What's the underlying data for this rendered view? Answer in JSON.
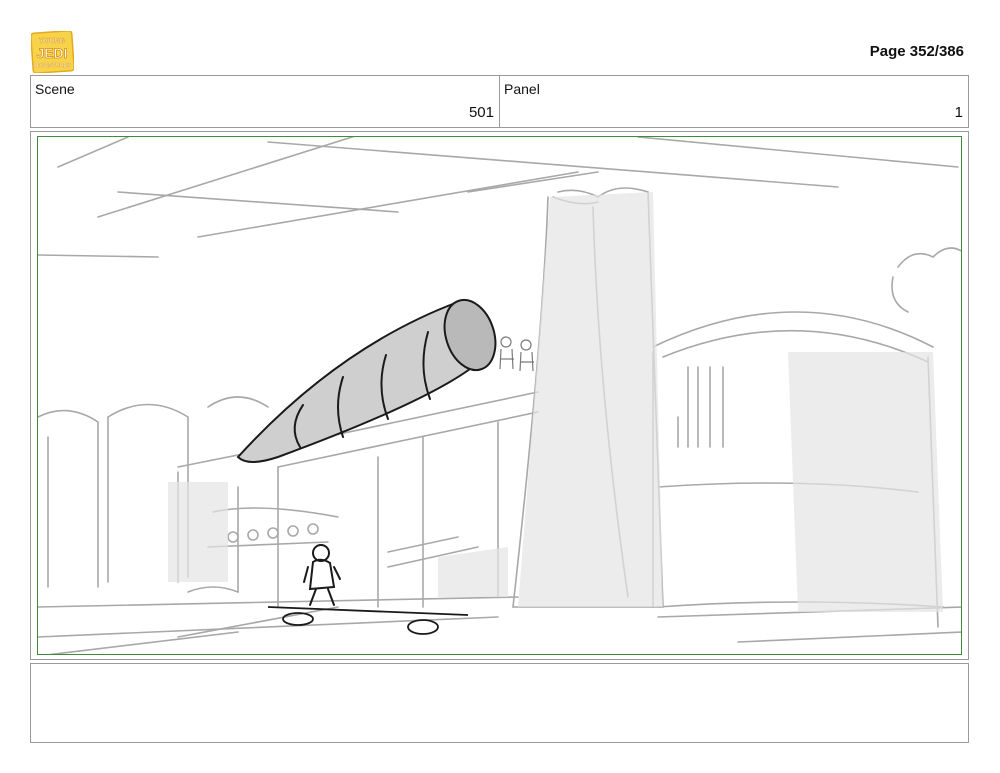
{
  "header": {
    "logo_icon": "young-jedi-adventures-logo",
    "logo_text": [
      "YOUNG",
      "JEDI",
      "ADVENTURES"
    ],
    "page_label": "Page 352/386"
  },
  "info": {
    "scene_label": "Scene",
    "scene_value": "501",
    "panel_label": "Panel",
    "panel_value": "1"
  },
  "panel": {
    "frame_color": "#3e8a3e",
    "sketch_color": "#a8a8a8",
    "ink_color": "#1a1a1a"
  },
  "notes": {
    "text": ""
  }
}
